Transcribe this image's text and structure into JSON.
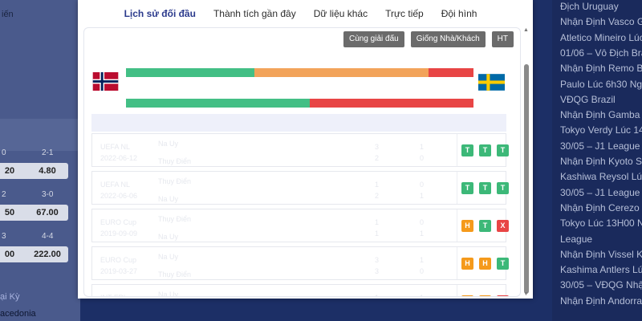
{
  "background_left": {
    "top_label": "iến",
    "odds_headers": [
      "0",
      "2-1",
      "2",
      "3-0",
      "3",
      "4-4"
    ],
    "odds_values": [
      "20",
      "4.80",
      "50",
      "67.00",
      "00",
      "222.00"
    ],
    "link1": "ại Kỳ",
    "link2": "acedonia"
  },
  "news": [
    "Địch Uruguay",
    "Nhận Định Vasco Gama",
    "Atletico Mineiro Lúc",
    "01/06 – Vô Địch Bra",
    "Nhận Định Remo Be",
    "Paulo Lúc 6h30 Ngà",
    "VĐQG Brazil",
    "Nhận Định Gamba O",
    "Tokyo Verdy Lúc 14h",
    "30/05 – J1 League",
    "Nhận Định Kyoto Sa",
    "Kashiwa Reysol Lúc",
    "30/05 – J1 League",
    "Nhận Định Cerezo O",
    "Tokyo Lúc 13H00 Ng",
    "League",
    "Nhận Định Vissel Ko",
    "Kashima Antlers Lúc",
    "30/05 – VĐQG Nhật",
    "Nhận Định Andorra"
  ],
  "tabs": [
    {
      "label": "Lịch sử đối đầu",
      "active": true
    },
    {
      "label": "Thành tích gần đây",
      "active": false
    },
    {
      "label": "Dữ liệu khác",
      "active": false
    },
    {
      "label": "Trực tiếp",
      "active": false
    },
    {
      "label": "Đội hình",
      "active": false
    }
  ],
  "filters": [
    "Cùng giải đấu",
    "Giống Nhà/Khách",
    "HT"
  ],
  "teams": {
    "home": "Na Uy",
    "away": "Thụy Điển"
  },
  "stat_bars": [
    {
      "green": 0.37,
      "orange": 0.5,
      "red": 0.13
    },
    {
      "green": 0.53,
      "orange": 0.0,
      "red": 0.47
    }
  ],
  "colors": {
    "green": "#43bf85",
    "orange": "#f2a35a",
    "red": "#e84545",
    "win": "#3cb878",
    "draw": "#f59a1b",
    "loss": "#e84545"
  },
  "matches": [
    {
      "league": "UEFA NL",
      "date": "2022-06-12",
      "team1": "Na Uy",
      "team2": "Thụy Điển",
      "s1": "3",
      "s2": "2",
      "h1": "1",
      "h2": "0",
      "results": [
        "T",
        "T",
        "T"
      ]
    },
    {
      "league": "UEFA NL",
      "date": "2022-06-06",
      "team1": "Thụy Điển",
      "team2": "Na Uy",
      "s1": "1",
      "s2": "2",
      "h1": "0",
      "h2": "1",
      "results": [
        "T",
        "T",
        "T"
      ]
    },
    {
      "league": "EURO Cup",
      "date": "2019-09-09",
      "team1": "Thụy Điển",
      "team2": "Na Uy",
      "s1": "1",
      "s2": "1",
      "h1": "0",
      "h2": "1",
      "results": [
        "H",
        "T",
        "X"
      ]
    },
    {
      "league": "EURO Cup",
      "date": "2019-03-27",
      "team1": "Na Uy",
      "team2": "Thụy Điển",
      "s1": "3",
      "s2": "3",
      "h1": "1",
      "h2": "0",
      "results": [
        "H",
        "H",
        "T"
      ]
    },
    {
      "league": "INT FRL",
      "date": "2017-06-14",
      "team1": "Na Uy",
      "team2": "Thụy Điển",
      "s1": "1",
      "s2": "1",
      "h1": "1",
      "h2": "0",
      "results": [
        "H",
        "H",
        "X"
      ]
    }
  ]
}
